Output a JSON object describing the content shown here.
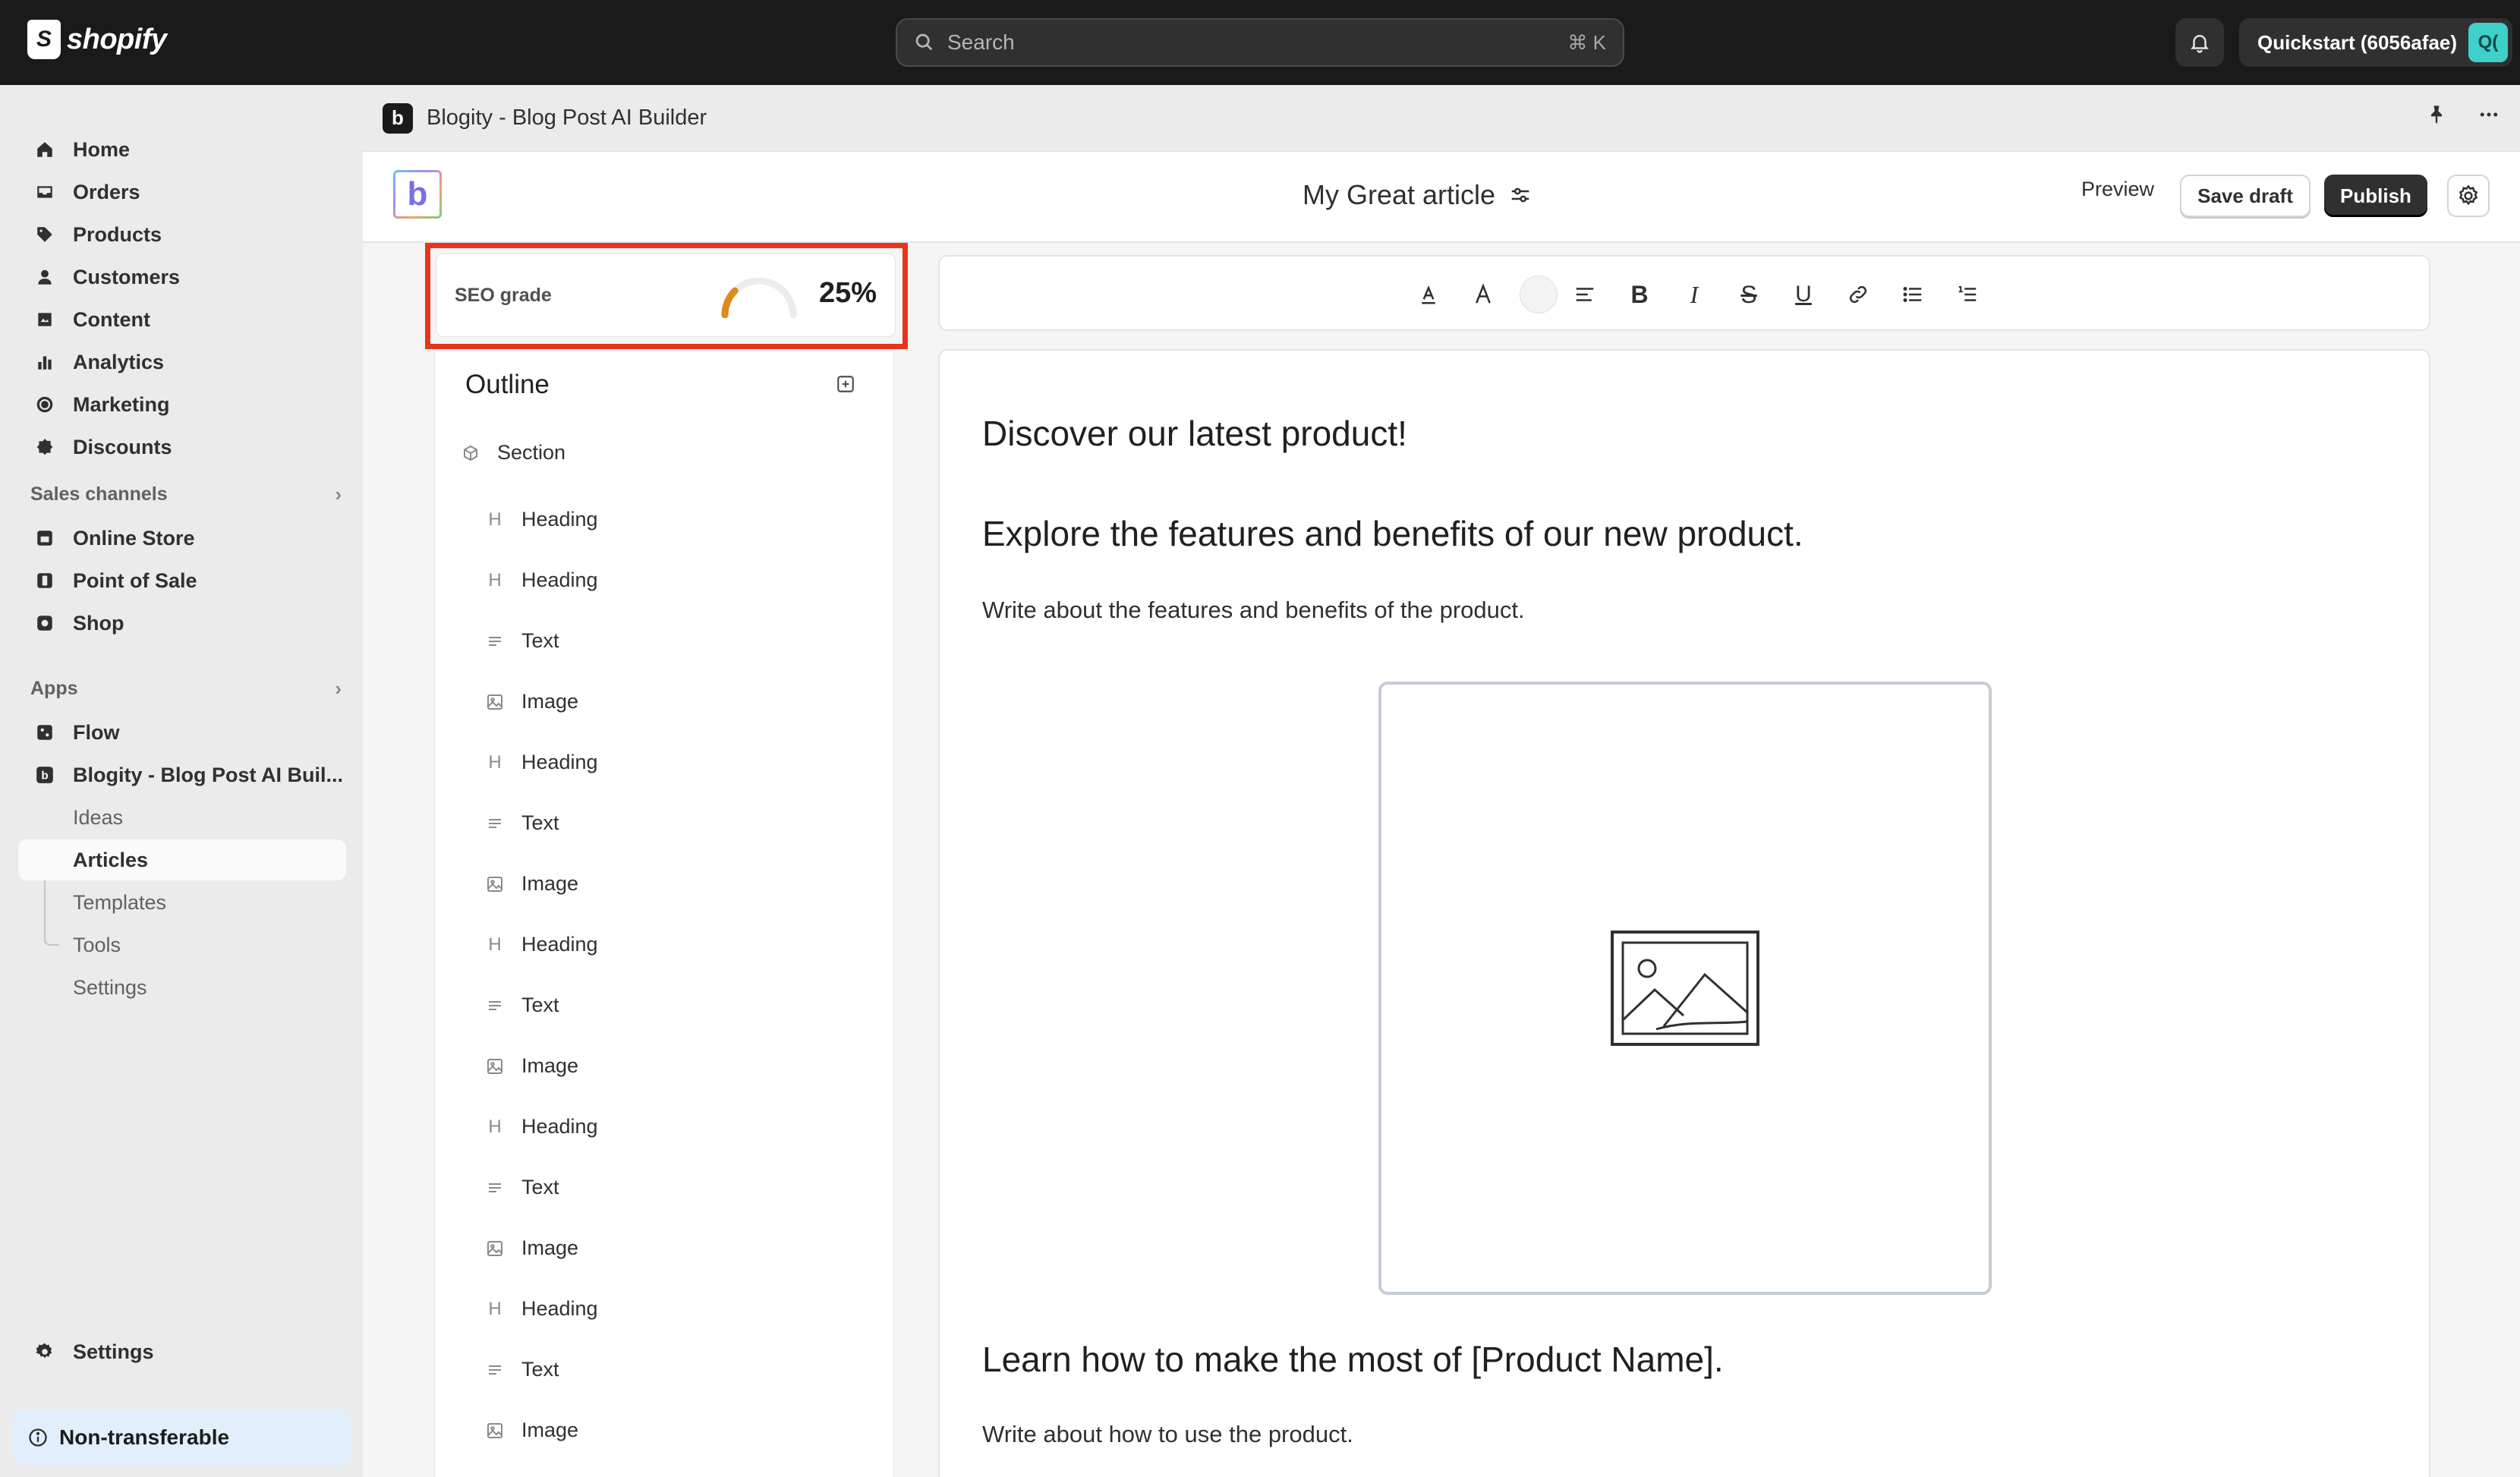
{
  "topbar": {
    "brand": "shopify",
    "search_placeholder": "Search",
    "search_shortcut": "⌘ K",
    "store_name": "Quickstart (6056afae)",
    "store_avatar": "Q("
  },
  "sidebar": {
    "main": [
      {
        "label": "Home",
        "icon": "home-icon"
      },
      {
        "label": "Orders",
        "icon": "orders-icon"
      },
      {
        "label": "Products",
        "icon": "tag-icon"
      },
      {
        "label": "Customers",
        "icon": "person-icon"
      },
      {
        "label": "Content",
        "icon": "content-icon"
      },
      {
        "label": "Analytics",
        "icon": "chart-icon"
      },
      {
        "label": "Marketing",
        "icon": "target-icon"
      },
      {
        "label": "Discounts",
        "icon": "discount-icon"
      }
    ],
    "sales_channels_label": "Sales channels",
    "sales_channels": [
      {
        "label": "Online Store"
      },
      {
        "label": "Point of Sale"
      },
      {
        "label": "Shop"
      }
    ],
    "apps_label": "Apps",
    "apps": [
      {
        "label": "Flow"
      },
      {
        "label": "Blogity - Blog Post AI Buil..."
      }
    ],
    "app_sub": [
      {
        "label": "Ideas"
      },
      {
        "label": "Articles"
      },
      {
        "label": "Templates"
      },
      {
        "label": "Tools"
      },
      {
        "label": "Settings"
      }
    ],
    "settings_label": "Settings",
    "nontransferable_label": "Non-transferable"
  },
  "app": {
    "badge": "b",
    "title": "Blogity - Blog Post AI Builder"
  },
  "editor": {
    "logo_letter": "b",
    "doc_title": "My Great article",
    "preview_label": "Preview",
    "save_label": "Save draft",
    "publish_label": "Publish"
  },
  "seo": {
    "label": "SEO grade",
    "value": "25%",
    "fraction": 0.25
  },
  "outline": {
    "title": "Outline",
    "items": [
      {
        "type": "Section"
      },
      {
        "type": "Heading"
      },
      {
        "type": "Heading"
      },
      {
        "type": "Text"
      },
      {
        "type": "Image"
      },
      {
        "type": "Heading"
      },
      {
        "type": "Text"
      },
      {
        "type": "Image"
      },
      {
        "type": "Heading"
      },
      {
        "type": "Text"
      },
      {
        "type": "Image"
      },
      {
        "type": "Heading"
      },
      {
        "type": "Text"
      },
      {
        "type": "Image"
      },
      {
        "type": "Heading"
      },
      {
        "type": "Text"
      },
      {
        "type": "Image"
      }
    ]
  },
  "content": {
    "heading1": "Discover our latest product!",
    "heading2": "Explore the features and benefits of our new product.",
    "paragraph1": "Write about the features and benefits of the product.",
    "heading3": "Learn how to make the most of [Product Name].",
    "paragraph2": "Write about how to use the product."
  }
}
